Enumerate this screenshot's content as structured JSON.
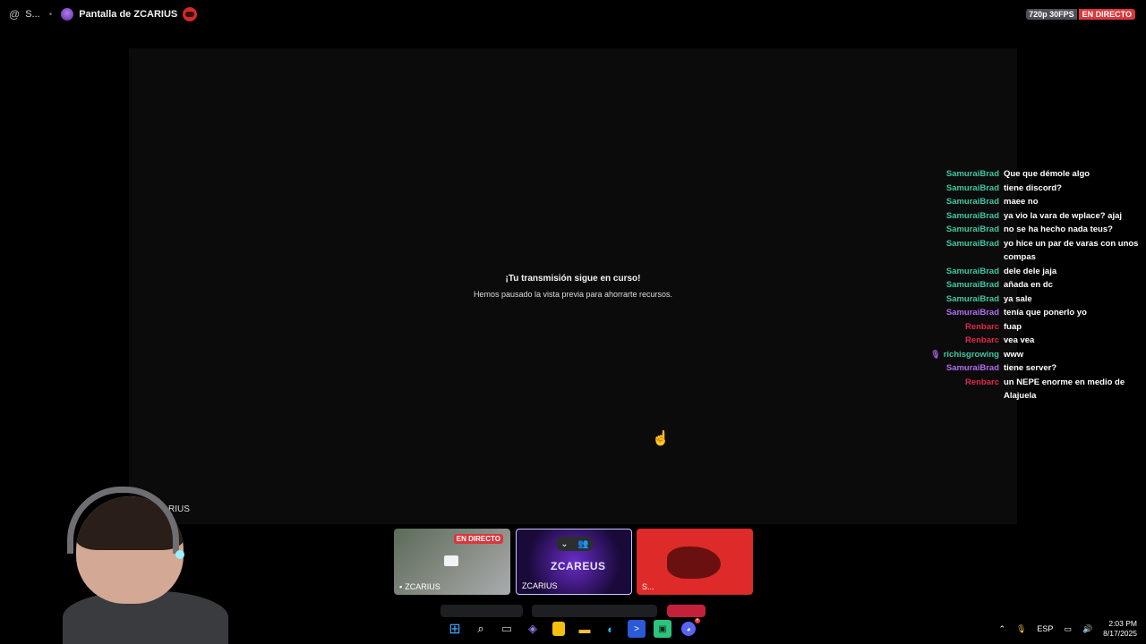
{
  "topbar": {
    "server_short": "S...",
    "title": "Pantalla de ZCARIUS",
    "quality": "720p 30FPS",
    "live": "EN DIRECTO"
  },
  "stage": {
    "paused_title": "¡Tu transmisión sigue en curso!",
    "paused_subtitle": "Hemos pausado la vista previa para ahorrarte recursos."
  },
  "chat": {
    "messages": [
      {
        "user": "SamuraiBrad",
        "color": "#3ec8a3",
        "text": "Que que démole algo"
      },
      {
        "user": "SamuraiBrad",
        "color": "#3ec8a3",
        "text": "tiene discord?"
      },
      {
        "user": "SamuraiBrad",
        "color": "#3ec8a3",
        "text": "maee no"
      },
      {
        "user": "SamuraiBrad",
        "color": "#3ec8a3",
        "text": "ya vio la vara de wplace? ajaj"
      },
      {
        "user": "SamuraiBrad",
        "color": "#3ec8a3",
        "text": "no se ha hecho nada teus?"
      },
      {
        "user": "SamuraiBrad",
        "color": "#3ec8a3",
        "text": "yo hice un par de varas con unos compas"
      },
      {
        "user": "SamuraiBrad",
        "color": "#3ec8a3",
        "text": "dele dele jaja"
      },
      {
        "user": "SamuraiBrad",
        "color": "#3ec8a3",
        "text": "añada en dc"
      },
      {
        "user": "SamuraiBrad",
        "color": "#3ec8a3",
        "text": "ya sale"
      },
      {
        "user": "SamuraiBrad",
        "color": "#b56ef0",
        "text": "tenía que ponerlo yo"
      },
      {
        "user": "Renbarc",
        "color": "#e0284b",
        "text": "fuap"
      },
      {
        "user": "Renbarc",
        "color": "#e0284b",
        "text": "vea vea"
      },
      {
        "user": "richisgrowing",
        "color": "#3ec8a3",
        "text": "www"
      },
      {
        "user": "SamuraiBrad",
        "color": "#b56ef0",
        "text": "tiene server?"
      },
      {
        "user": "Renbarc",
        "color": "#e0284b",
        "text": "un NEPE enorme en medio de Alajuela"
      }
    ]
  },
  "webcam": {
    "label": "RIUS"
  },
  "thumbnails": [
    {
      "name": "ZCARIUS",
      "live": "EN DIRECTO"
    },
    {
      "name": "ZCARIUS",
      "logo": "ZCAREUS"
    },
    {
      "name": "S..."
    }
  ],
  "tray": {
    "lang": "ESP",
    "time": "2:03 PM",
    "date": "8/17/2025"
  },
  "colors": {
    "live_red": "#da373c",
    "chat_green": "#3ec8a3",
    "chat_purple": "#b56ef0",
    "chat_red": "#e0284b"
  }
}
